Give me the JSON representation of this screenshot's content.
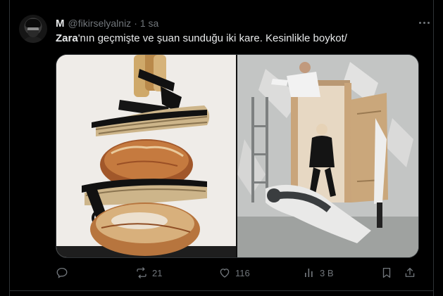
{
  "post": {
    "author": {
      "display_name": "M",
      "handle": "@fikirselyalniz",
      "separator": "·",
      "time": "1 sa"
    },
    "text": {
      "brand": "Zara",
      "rest": "'nın geçmişte ve şuan sunduğu iki kare. Kesinlikle boykot/"
    },
    "media": [
      {
        "icon": "photo-shoe-bread"
      },
      {
        "icon": "photo-fashion-shoot"
      }
    ],
    "actions": {
      "reply": {
        "icon": "reply-icon"
      },
      "repost": {
        "icon": "repost-icon",
        "count": "21"
      },
      "like": {
        "icon": "like-icon",
        "count": "116"
      },
      "views": {
        "icon": "views-icon",
        "count": "3 B"
      },
      "bookmark": {
        "icon": "bookmark-icon"
      },
      "share": {
        "icon": "share-icon"
      }
    }
  },
  "colors": {
    "background": "#000000",
    "text": "#e7e9ea",
    "secondary": "#71767b",
    "border": "#2f3336"
  }
}
